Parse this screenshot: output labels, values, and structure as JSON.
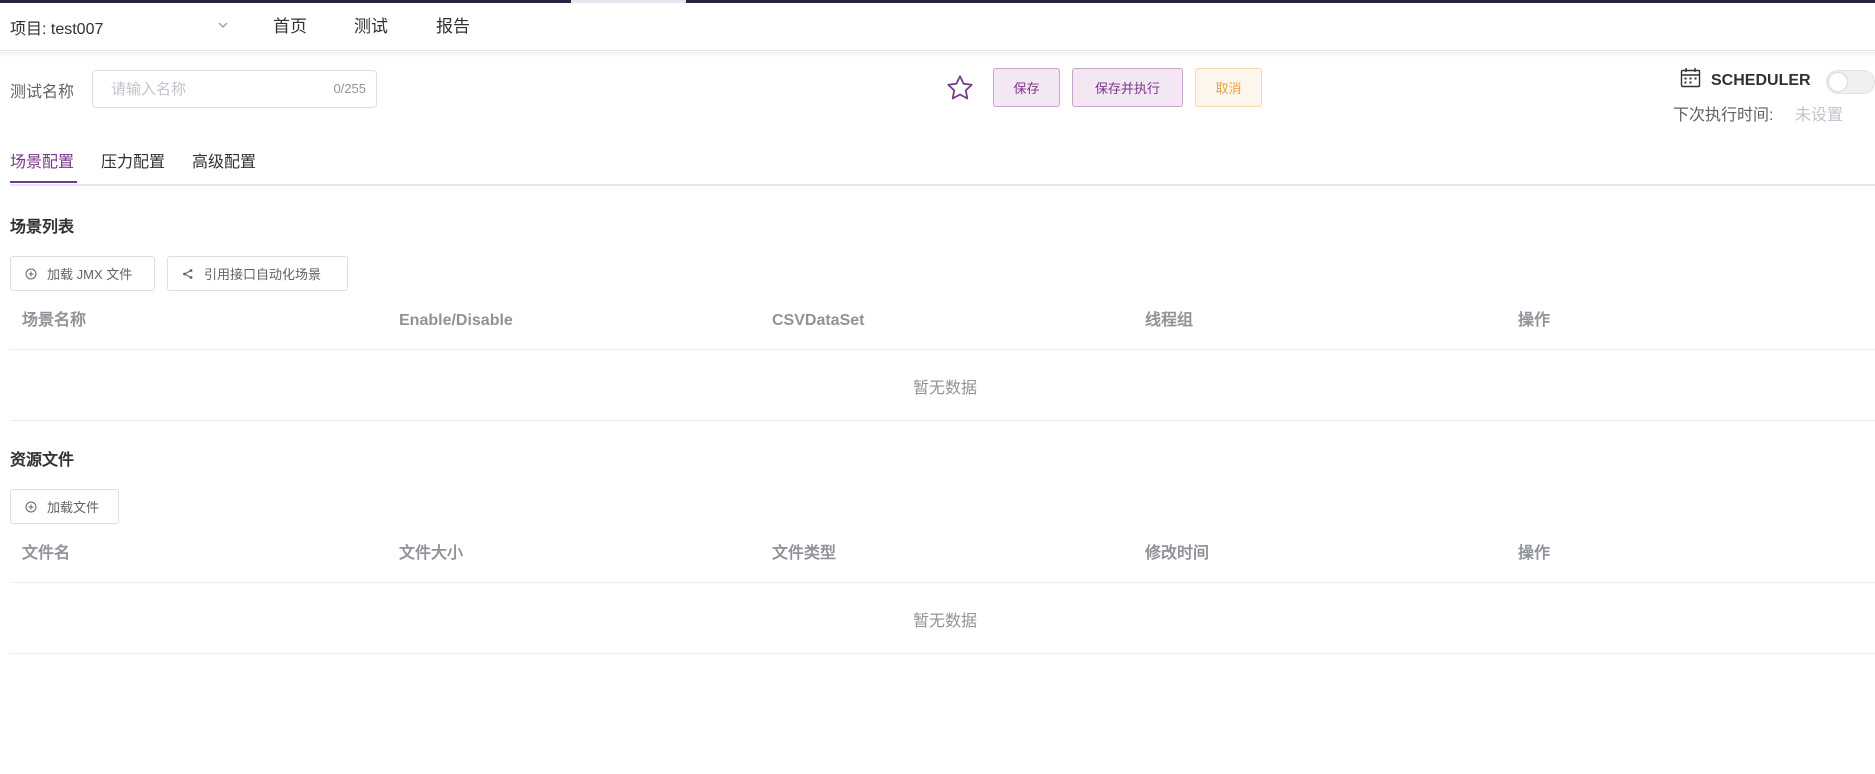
{
  "header": {
    "project_label": "项目: test007",
    "nav": [
      "首页",
      "测试",
      "报告"
    ]
  },
  "form": {
    "name_label": "测试名称",
    "name_value": "",
    "name_placeholder": "请输入名称",
    "name_counter": "0/255"
  },
  "toolbar": {
    "save_label": "保存",
    "save_run_label": "保存并执行",
    "cancel_label": "取消"
  },
  "scheduler": {
    "label": "SCHEDULER",
    "enabled": false,
    "next_label": "下次执行时间:",
    "next_value": "未设置"
  },
  "tabs": [
    {
      "label": "场景配置",
      "active": true
    },
    {
      "label": "压力配置",
      "active": false
    },
    {
      "label": "高级配置",
      "active": false
    }
  ],
  "scenario": {
    "title": "场景列表",
    "load_jmx_label": "加载 JMX 文件",
    "reference_label": "引用接口自动化场景",
    "columns": [
      "场景名称",
      "Enable/Disable",
      "CSVDataSet",
      "线程组",
      "操作"
    ],
    "rows": [],
    "empty_text": "暂无数据"
  },
  "resources": {
    "title": "资源文件",
    "load_file_label": "加载文件",
    "columns": [
      "文件名",
      "文件大小",
      "文件类型",
      "修改时间",
      "操作"
    ],
    "rows": [],
    "empty_text": "暂无数据"
  },
  "colors": {
    "primary": "#783887",
    "top_bar": "#2b2340",
    "warning": "#e6a23c"
  }
}
